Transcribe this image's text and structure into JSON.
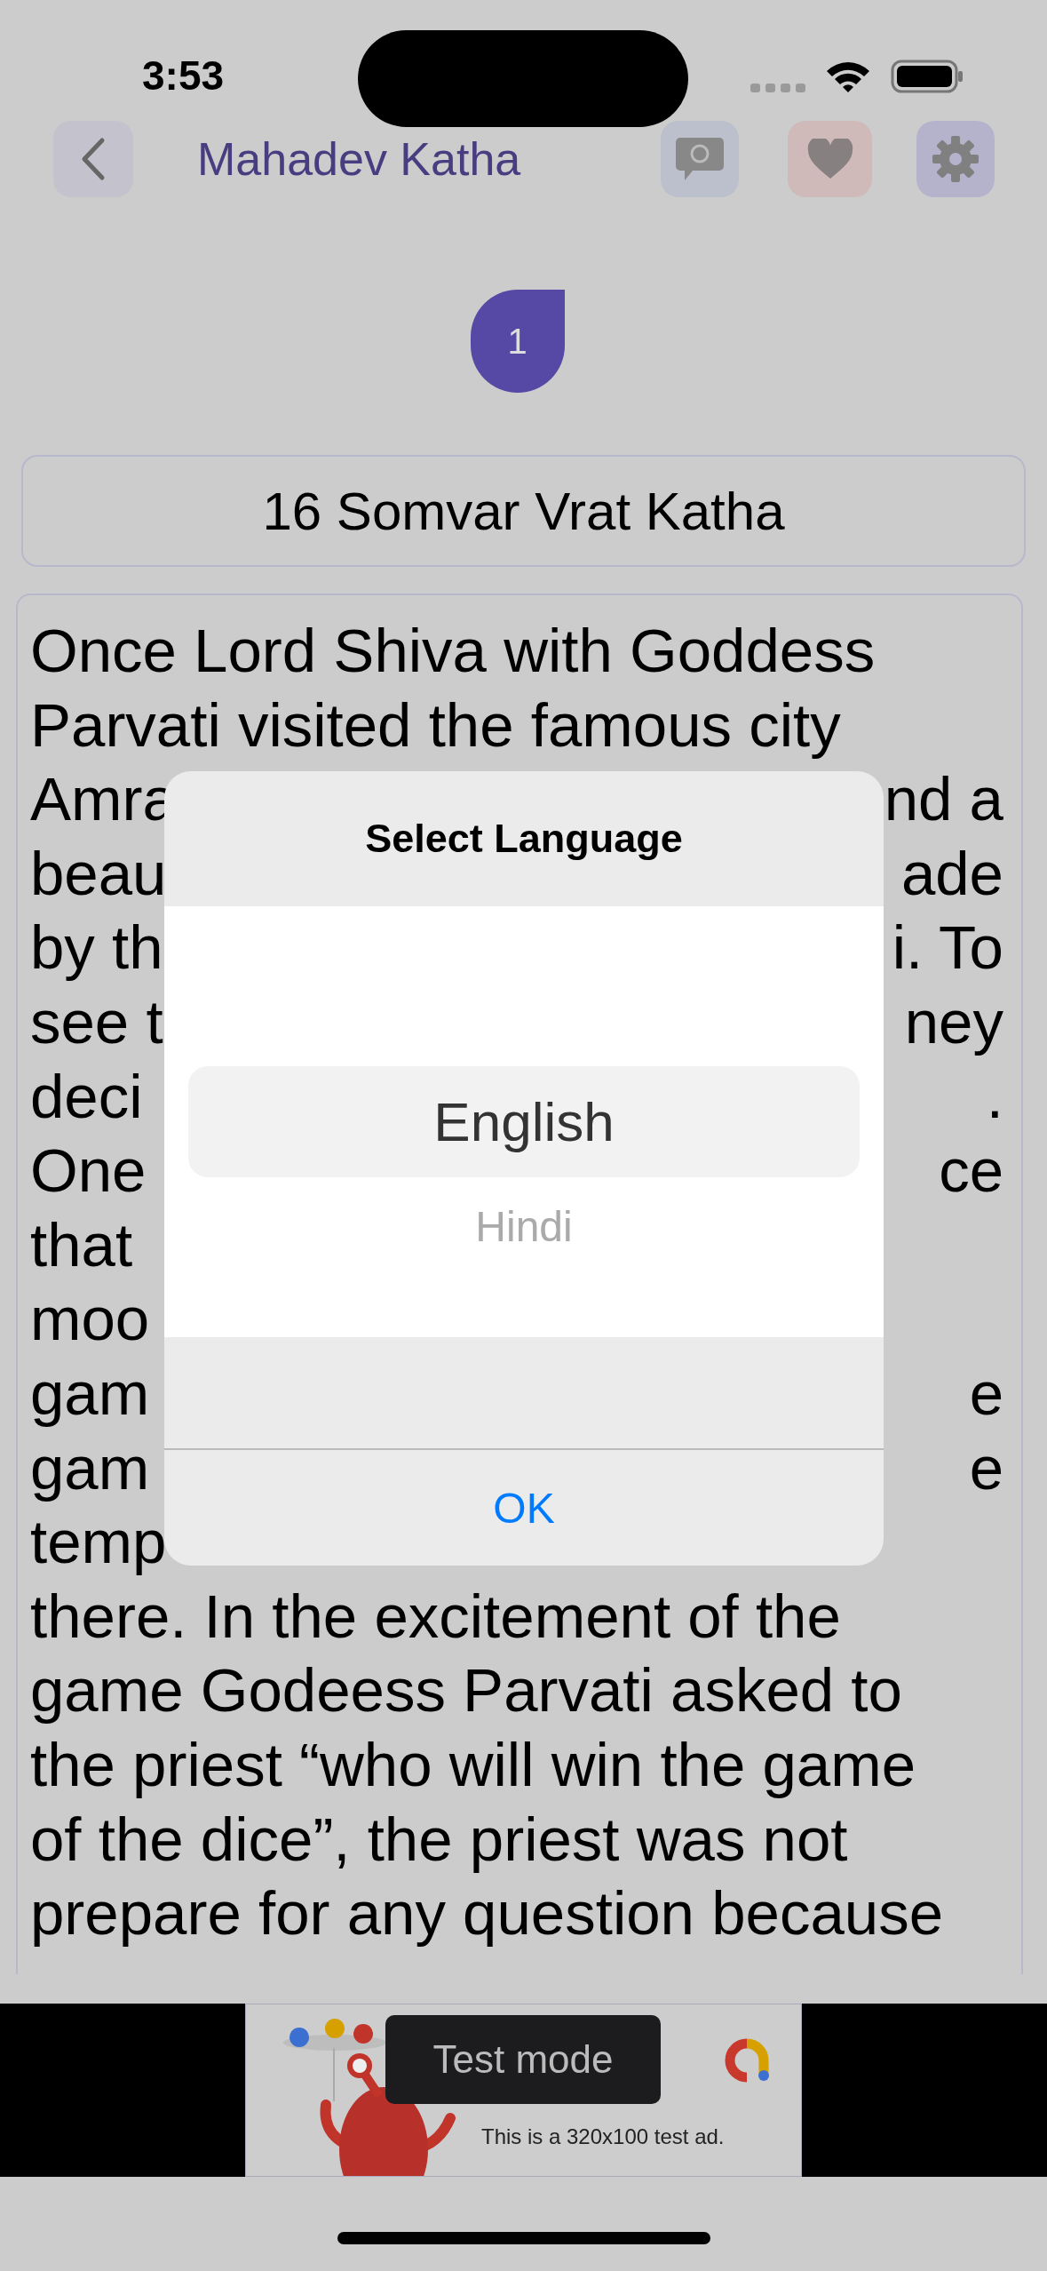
{
  "status_bar": {
    "time": "3:53"
  },
  "nav": {
    "title": "Mahadev Katha"
  },
  "chapter_badge": "1",
  "story": {
    "title": "16 Somvar Vrat Katha",
    "lines": [
      {
        "left": "Once Lord Shiva with Goddess"
      },
      {
        "left": "Parvati visited the famous city"
      },
      {
        "left": "Amra",
        "right": "nd a"
      },
      {
        "left": "beau",
        "right": "ade"
      },
      {
        "left": "by th",
        "right": "i. To"
      },
      {
        "left": "see t",
        "right": "ney"
      },
      {
        "left": "deci",
        "right": "."
      },
      {
        "left": "One",
        "right": "ce"
      },
      {
        "left": "that"
      },
      {
        "left": "moo"
      },
      {
        "left": "gam",
        "right": "e"
      },
      {
        "left": "gam",
        "right": "e"
      },
      {
        "left": "temp"
      },
      {
        "left": "there. In the excitement of the"
      },
      {
        "left": "game Godeess Parvati asked to"
      },
      {
        "left": "the priest “who will win the game"
      },
      {
        "left": "of the dice”, the priest was not"
      },
      {
        "left": "prepare for any question because"
      }
    ]
  },
  "dialog": {
    "title": "Select Language",
    "options": [
      {
        "label": "English",
        "selected": true
      },
      {
        "label": "Hindi",
        "selected": false
      }
    ],
    "button": "OK"
  },
  "ad": {
    "toast": "Test mode",
    "caption": "This is a 320x100 test ad."
  }
}
